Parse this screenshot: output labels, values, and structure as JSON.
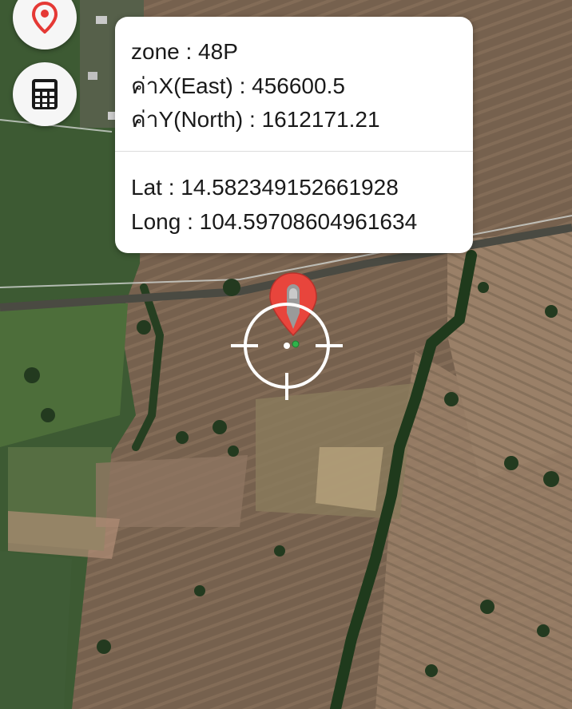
{
  "coordinates": {
    "zone": "zone : 48P",
    "east": "ค่าX(East) : 456600.5",
    "north": "ค่าY(North) : 1612171.21",
    "lat": "Lat : 14.582349152661928",
    "long": "Long : 104.59708604961634"
  },
  "buttons": {
    "location_icon": "location-pin-icon",
    "calculator_icon": "calculator-icon"
  },
  "colors": {
    "marker": "#e8453c",
    "crosshair": "#ffffff",
    "accent_green": "#2fb34a"
  }
}
